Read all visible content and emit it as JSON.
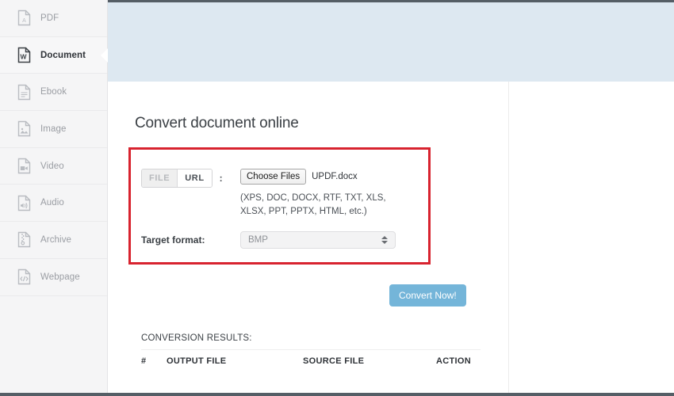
{
  "sidebar": {
    "items": [
      {
        "label": "PDF",
        "icon": "pdf-file-icon",
        "active": false
      },
      {
        "label": "Document",
        "icon": "word-document-icon",
        "active": true
      },
      {
        "label": "Ebook",
        "icon": "ebook-file-icon",
        "active": false
      },
      {
        "label": "Image",
        "icon": "image-file-icon",
        "active": false
      },
      {
        "label": "Video",
        "icon": "video-file-icon",
        "active": false
      },
      {
        "label": "Audio",
        "icon": "audio-file-icon",
        "active": false
      },
      {
        "label": "Archive",
        "icon": "archive-file-icon",
        "active": false
      },
      {
        "label": "Webpage",
        "icon": "webpage-file-icon",
        "active": false
      }
    ]
  },
  "page": {
    "title": "Convert document online"
  },
  "form": {
    "source_tabs": [
      {
        "label": "FILE",
        "selected": true
      },
      {
        "label": "URL",
        "selected": false
      }
    ],
    "colon": ":",
    "choose_files_label": "Choose Files",
    "selected_file": "UPDF.docx",
    "formats_hint": "(XPS, DOC, DOCX, RTF, TXT, XLS, XLSX, PPT, PPTX, HTML, etc.)",
    "target_format_label": "Target format:",
    "target_format_value": "BMP",
    "target_format_options": [
      "BMP"
    ]
  },
  "actions": {
    "convert_label": "Convert Now!"
  },
  "results": {
    "heading": "CONVERSION RESULTS:",
    "columns": [
      "#",
      "OUTPUT FILE",
      "SOURCE FILE",
      "ACTION"
    ],
    "rows": []
  },
  "colors": {
    "accent_button": "#74b5d9",
    "banner": "#dde8f1",
    "sidebar": "#f5f5f6",
    "highlight_box": "#d8232f",
    "chrome": "#555e66"
  }
}
